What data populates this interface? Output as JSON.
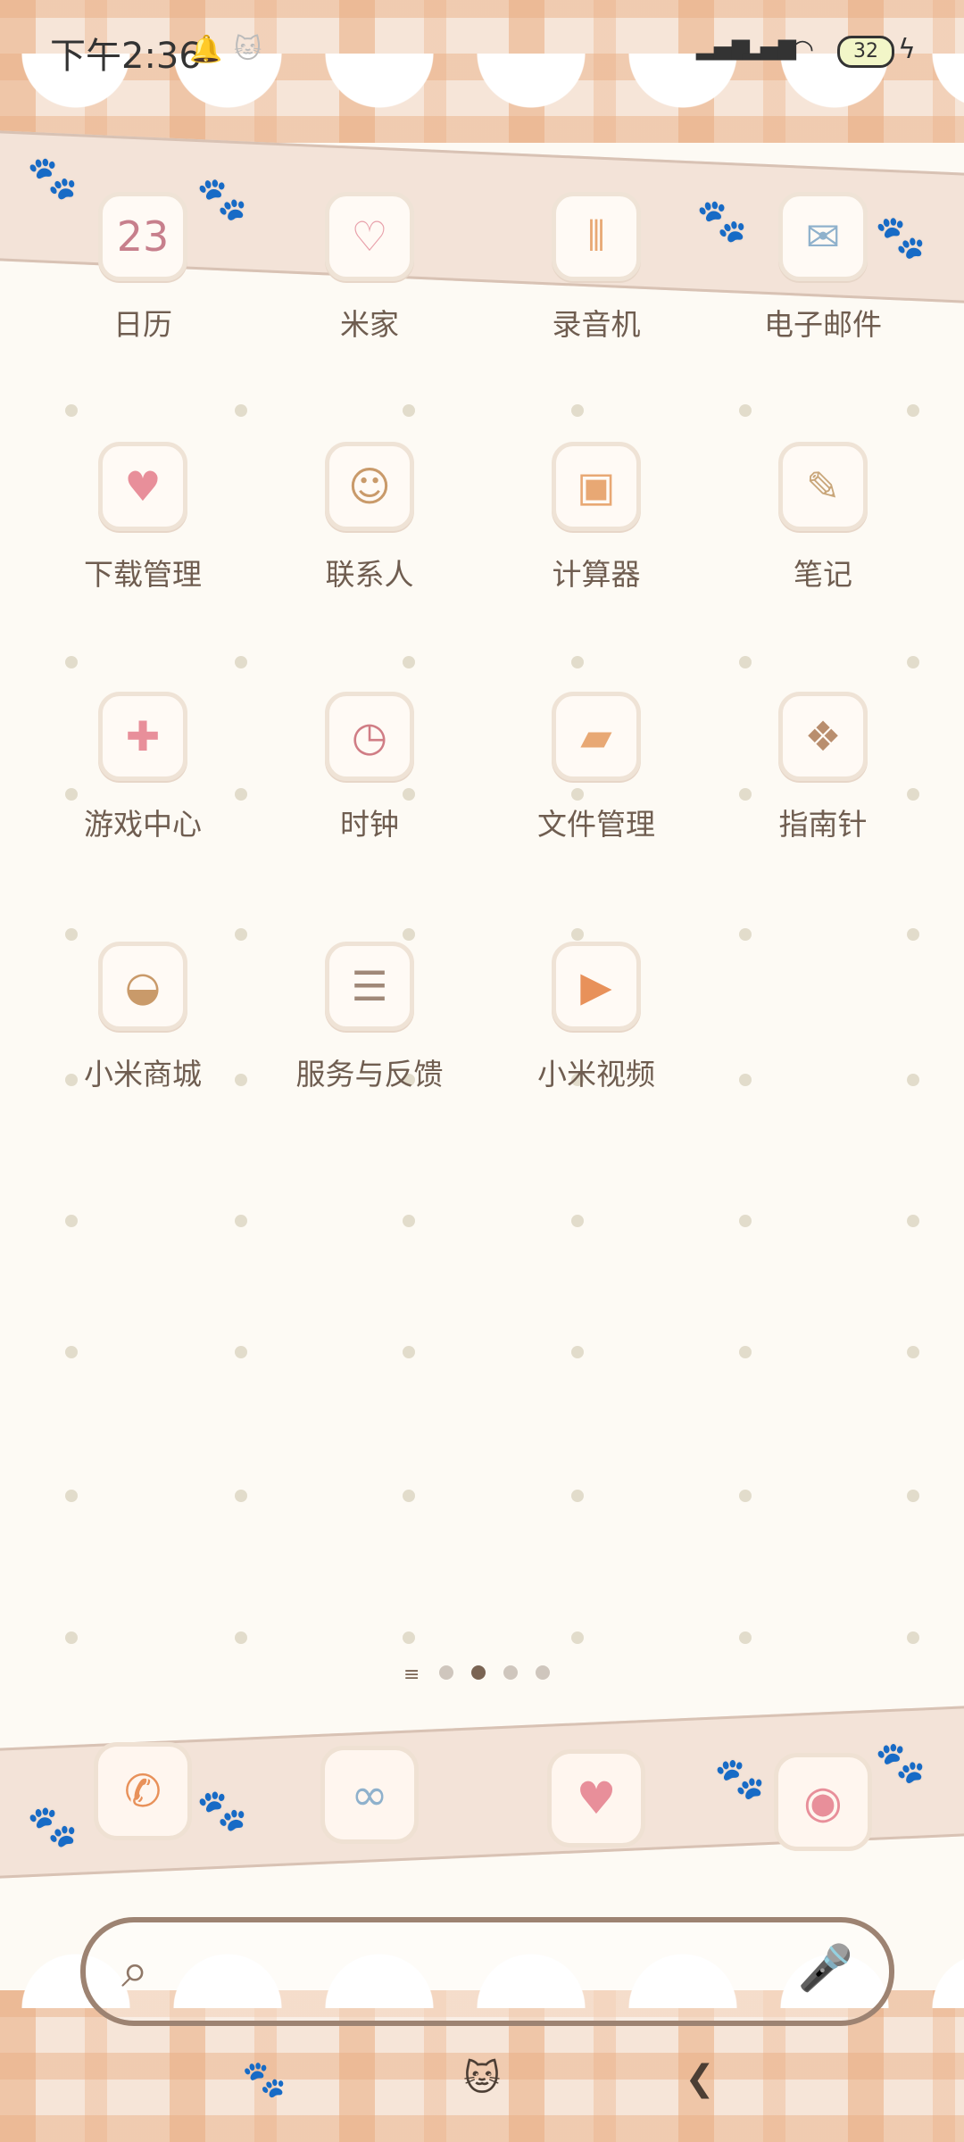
{
  "status_bar": {
    "time": "下午2:36",
    "battery": "32",
    "icons": [
      "notification-icon",
      "cat-icon",
      "signal-icon",
      "signal-icon",
      "wifi-icon",
      "battery-icon",
      "charging-icon"
    ]
  },
  "apps": [
    {
      "label": "日历",
      "icon": "calendar-icon",
      "glyph": "23",
      "color": "#c77f8c"
    },
    {
      "label": "米家",
      "icon": "mijia-icon",
      "glyph": "♡",
      "color": "#e8a0aa"
    },
    {
      "label": "录音机",
      "icon": "recorder-icon",
      "glyph": "⦀",
      "color": "#e8a874"
    },
    {
      "label": "电子邮件",
      "icon": "email-icon",
      "glyph": "✉",
      "color": "#8fb1cc"
    },
    {
      "label": "下载管理",
      "icon": "download-icon",
      "glyph": "♥",
      "color": "#e88f9a"
    },
    {
      "label": "联系人",
      "icon": "contacts-icon",
      "glyph": "☺",
      "color": "#c99a6a"
    },
    {
      "label": "计算器",
      "icon": "calculator-icon",
      "glyph": "▣",
      "color": "#e8a874"
    },
    {
      "label": "笔记",
      "icon": "notes-icon",
      "glyph": "✎",
      "color": "#c9a67a"
    },
    {
      "label": "游戏中心",
      "icon": "gamepad-icon",
      "glyph": "✚",
      "color": "#e88f9a"
    },
    {
      "label": "时钟",
      "icon": "clock-icon",
      "glyph": "◷",
      "color": "#d07d85"
    },
    {
      "label": "文件管理",
      "icon": "folder-icon",
      "glyph": "▰",
      "color": "#e8a874"
    },
    {
      "label": "指南针",
      "icon": "compass-icon",
      "glyph": "❖",
      "color": "#b98e6e"
    },
    {
      "label": "小米商城",
      "icon": "mistore-icon",
      "glyph": "◒",
      "color": "#c99a6a"
    },
    {
      "label": "服务与反馈",
      "icon": "feedback-icon",
      "glyph": "☰",
      "color": "#a08878"
    },
    {
      "label": "小米视频",
      "icon": "video-icon",
      "glyph": "▶",
      "color": "#e8915a"
    }
  ],
  "dock": [
    {
      "icon": "phone-icon",
      "glyph": "✆",
      "color": "#e8915a"
    },
    {
      "icon": "browser-icon",
      "glyph": "∞",
      "color": "#8fb1cc"
    },
    {
      "icon": "messages-icon",
      "glyph": "♥",
      "color": "#e88f9a"
    },
    {
      "icon": "camera-icon",
      "glyph": "◉",
      "color": "#e88f9a"
    }
  ],
  "pager": {
    "pages": 4,
    "active": 2
  },
  "search": {
    "search_icon": "search-icon",
    "mic_icon": "mic-icon"
  },
  "nav": {
    "icons": [
      "paw-icon",
      "cat-face-icon",
      "back-icon"
    ]
  }
}
